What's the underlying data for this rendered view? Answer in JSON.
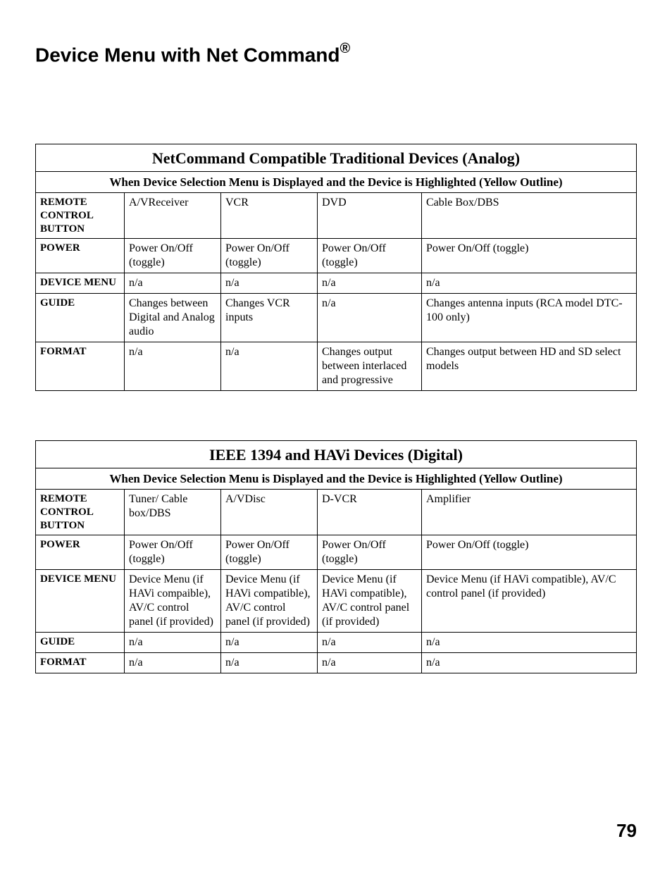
{
  "page": {
    "title_pre": "Device Menu with Net Command",
    "title_reg": "®",
    "number": "79"
  },
  "table1": {
    "title": "NetCommand Compatible Traditional Devices (Analog)",
    "subtitle": "When Device Selection Menu is Displayed and the Device is Highlighted (Yellow Outline)",
    "rows": [
      {
        "hdr": "REMOTE CONTROL BUTTON",
        "c1": "A/VReceiver",
        "c2": "VCR",
        "c3": "DVD",
        "c4": "Cable Box/DBS"
      },
      {
        "hdr": "POWER",
        "c1": "Power On/Off (toggle)",
        "c2": "Power On/Off (toggle)",
        "c3": "Power On/Off (toggle)",
        "c4": "Power On/Off (toggle)"
      },
      {
        "hdr": "DEVICE MENU",
        "c1": "n/a",
        "c2": "n/a",
        "c3": "n/a",
        "c4": "n/a"
      },
      {
        "hdr": "GUIDE",
        "c1": "Changes between Digital and Analog audio",
        "c2": "Changes VCR inputs",
        "c3": "n/a",
        "c4": "Changes antenna inputs (RCA model DTC-100 only)"
      },
      {
        "hdr": "FORMAT",
        "c1": "n/a",
        "c2": "n/a",
        "c3": "Changes output between interlaced and progressive",
        "c4": "Changes output between HD and SD select models"
      }
    ]
  },
  "table2": {
    "title": "IEEE 1394 and HAVi Devices (Digital)",
    "subtitle": "When Device Selection Menu is Displayed and the Device is Highlighted (Yellow Outline)",
    "rows": [
      {
        "hdr": "REMOTE CONTROL BUTTON",
        "c1": "Tuner/ Cable box/DBS",
        "c2": "A/VDisc",
        "c3": "D-VCR",
        "c4": "Amplifier"
      },
      {
        "hdr": "POWER",
        "c1": "Power On/Off (toggle)",
        "c2": "Power On/Off (toggle)",
        "c3": "Power On/Off (toggle)",
        "c4": "Power On/Off (toggle)"
      },
      {
        "hdr": "DEVICE MENU",
        "c1": "Device Menu (if HAVi compaible), AV/C control panel (if provided)",
        "c2": "Device Menu (if HAVi compatible), AV/C control panel (if provided)",
        "c3": "Device Menu (if HAVi compatible), AV/C control panel (if provided)",
        "c4": "Device Menu (if HAVi compatible), AV/C control panel (if provided)"
      },
      {
        "hdr": "GUIDE",
        "c1": "n/a",
        "c2": "n/a",
        "c3": "n/a",
        "c4": "n/a"
      },
      {
        "hdr": "FORMAT",
        "c1": "n/a",
        "c2": "n/a",
        "c3": "n/a",
        "c4": "n/a"
      }
    ]
  }
}
